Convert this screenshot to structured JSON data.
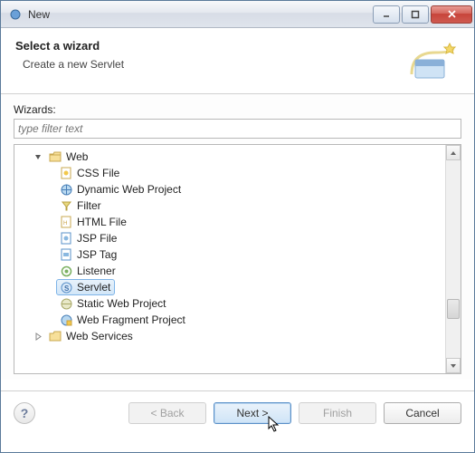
{
  "window": {
    "title": "New"
  },
  "header": {
    "title": "Select a wizard",
    "subtitle": "Create a new Servlet"
  },
  "filter": {
    "label": "Wizards:",
    "placeholder": "type filter text"
  },
  "tree": {
    "web": {
      "label": "Web",
      "children": {
        "css": "CSS File",
        "dynweb": "Dynamic Web Project",
        "filter": "Filter",
        "html": "HTML File",
        "jspfile": "JSP File",
        "jsptag": "JSP Tag",
        "listener": "Listener",
        "servlet": "Servlet",
        "static": "Static Web Project",
        "webfrag": "Web Fragment Project"
      }
    },
    "webservices": {
      "label": "Web Services"
    }
  },
  "buttons": {
    "back": "< Back",
    "next": "Next >",
    "finish": "Finish",
    "cancel": "Cancel"
  }
}
